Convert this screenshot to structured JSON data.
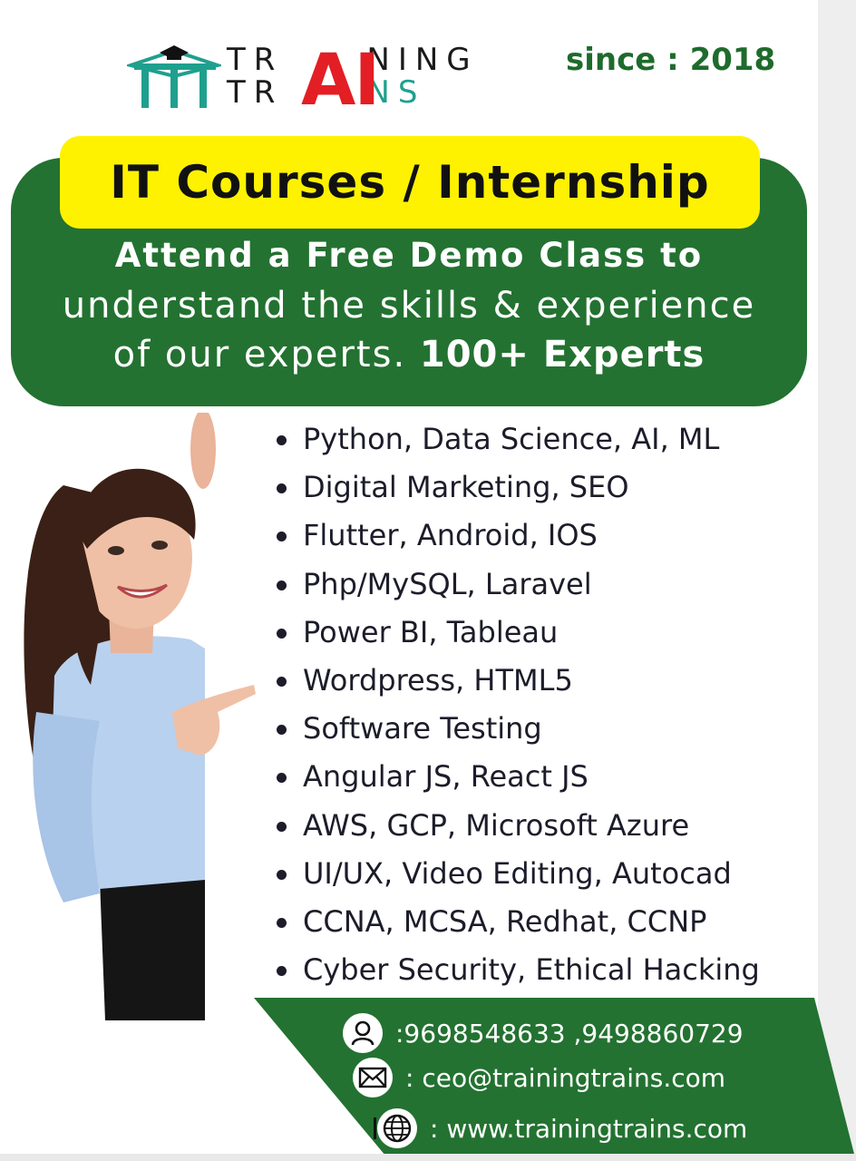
{
  "brand": {
    "logo_line1_a": "TR",
    "logo_line1_b": "NING",
    "logo_line2_a": "TR",
    "logo_line2_b": "NS",
    "logo_ai": "AI",
    "since": "since : 2018"
  },
  "headline": "IT Courses / Internship",
  "offer": {
    "line1": "Attend a Free Demo Class to",
    "line2": "understand the skills & experience",
    "line3_regular": "of our experts.",
    "line3_bold": "100+ Experts"
  },
  "courses": [
    "Python, Data Science, AI, ML",
    "Digital Marketing, SEO",
    "Flutter, Android, IOS",
    "Php/MySQL, Laravel",
    "Power BI, Tableau",
    "Wordpress, HTML5",
    "Software Testing",
    "Angular JS, React JS",
    "AWS, GCP, Microsoft Azure",
    "UI/UX, Video Editing, Autocad",
    "CCNA, MCSA, Redhat, CCNP",
    "Cyber Security, Ethical Hacking"
  ],
  "contact": {
    "phone": ":9698548633 ,9498860729",
    "email": ": ceo@trainingtrains.com",
    "website": ": www.trainingtrains.com",
    "phone_icon": "person-icon",
    "email_icon": "envelope-icon",
    "web_icon": "globe-icon"
  },
  "colors": {
    "green": "#237231",
    "yellow": "#fef200",
    "logo_red": "#e31e24",
    "logo_teal": "#1fa08e",
    "since_green": "#1e6b2c"
  }
}
